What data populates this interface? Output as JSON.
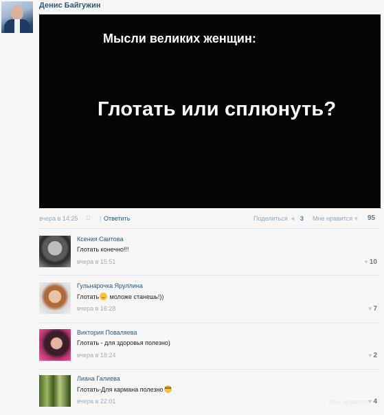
{
  "post": {
    "author": "Денис Байгужин",
    "image_line1": "Мысли великих женщин:",
    "image_line2": "Глотать или сплюнуть?",
    "date": "вчера в 14:25",
    "separator": "|",
    "reply_label": "Ответить",
    "share_label": "Поделиться",
    "share_count": "3",
    "likes_label": "Мне нравится",
    "likes_count": "95"
  },
  "comments": [
    {
      "name": "Ксения Саитова",
      "text": "Глотать конечно!!!",
      "date": "вчера в 15:51",
      "likes": "10"
    },
    {
      "name": "Гульнарочка Яруллина",
      "text_before": "Глотать",
      "text_after": " моложе станешь!))",
      "date": "вчера в 16:28",
      "likes": "7"
    },
    {
      "name": "Виктория Поваляева",
      "text": "Глотать - для здоровья полезно)",
      "date": "вчера в 18:24",
      "likes": "2"
    },
    {
      "name": "Лиана Галиева",
      "text": "Глотать-Для кармана полезно",
      "date": "вчера в 22:01",
      "likes": "4",
      "faded_likes_label": "Мне нравится"
    }
  ],
  "icons": {
    "share": "megaphone-icon",
    "like": "heart-icon",
    "device": "apple-icon",
    "emoji_smile": "smile-emoji-icon",
    "emoji_nerd": "nerd-emoji-icon"
  },
  "colors": {
    "link": "#2b587a",
    "meta": "#9aa7b5",
    "image_bg": "#050505"
  }
}
